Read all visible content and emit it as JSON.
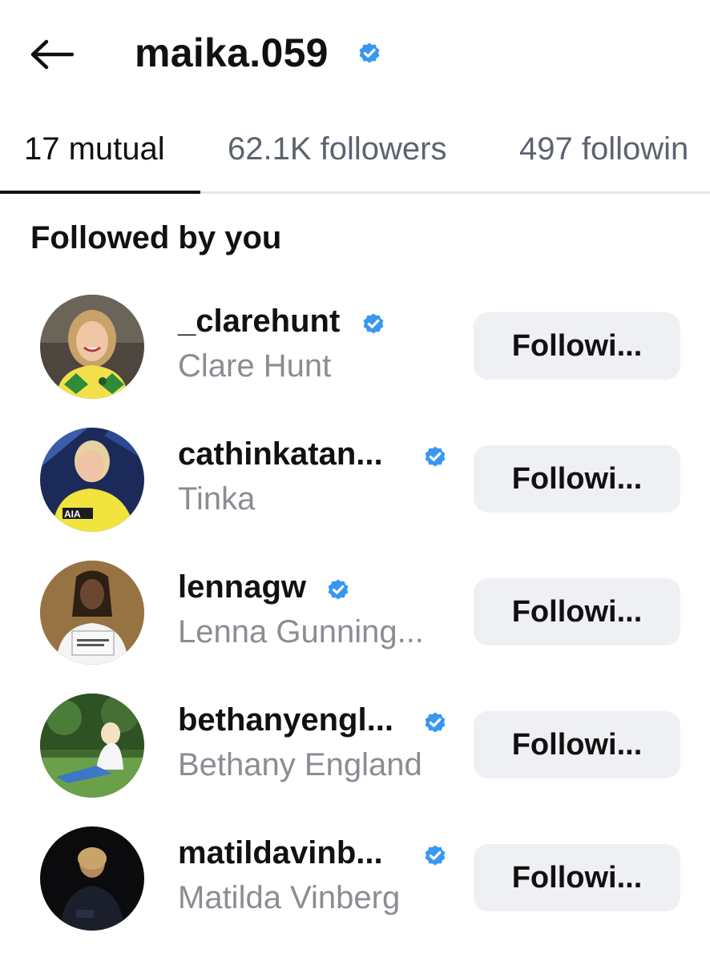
{
  "header": {
    "title": "maika.059"
  },
  "tabs": [
    {
      "label": "17 mutual"
    },
    {
      "label": "62.1K followers"
    },
    {
      "label": "497 followin"
    }
  ],
  "section": {
    "title": "Followed by you"
  },
  "users": [
    {
      "username": "_clarehunt",
      "full_name": "Clare Hunt",
      "button": "Followi..."
    },
    {
      "username": "cathinkatan...",
      "full_name": "Tinka",
      "button": "Followi..."
    },
    {
      "username": "lennagw",
      "full_name": "Lenna Gunning...",
      "button": "Followi..."
    },
    {
      "username": "bethanyengl...",
      "full_name": "Bethany England",
      "button": "Followi..."
    },
    {
      "username": "matildavinb...",
      "full_name": "Matilda Vinberg",
      "button": "Followi..."
    }
  ],
  "colors": {
    "verified": "#3897f0",
    "button_bg": "#eff0f4",
    "secondary_text": "#8a8d93"
  },
  "icons": {
    "back": "arrow-left-icon",
    "verified": "verified-badge-icon"
  }
}
